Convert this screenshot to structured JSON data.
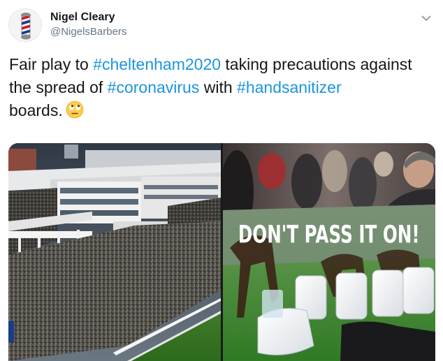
{
  "author": {
    "display_name": "Nigel Cleary",
    "handle": "@NigelsBarbers",
    "avatar_icon": "barber-pole-icon"
  },
  "menu": {
    "icon": "chevron-down-icon"
  },
  "tweet": {
    "text_1": "Fair play to ",
    "hashtag_1": "#cheltenham2020",
    "text_2": " taking precautions against the spread of ",
    "hashtag_2": "#coronavirus",
    "text_3": " with ",
    "hashtag_3": "#handsanitizer",
    "text_4": " boards.",
    "emoji": "face-with-rolling-eyes-icon"
  },
  "media": {
    "left_image": "racecourse-grandstand-crowd-photo",
    "right_image": "hand-sanitizer-board-photo",
    "board_text": "DON'T PASS IT ON!"
  },
  "colors": {
    "hashtag": "#1b95e0",
    "handle": "#657786",
    "text": "#14171a"
  }
}
